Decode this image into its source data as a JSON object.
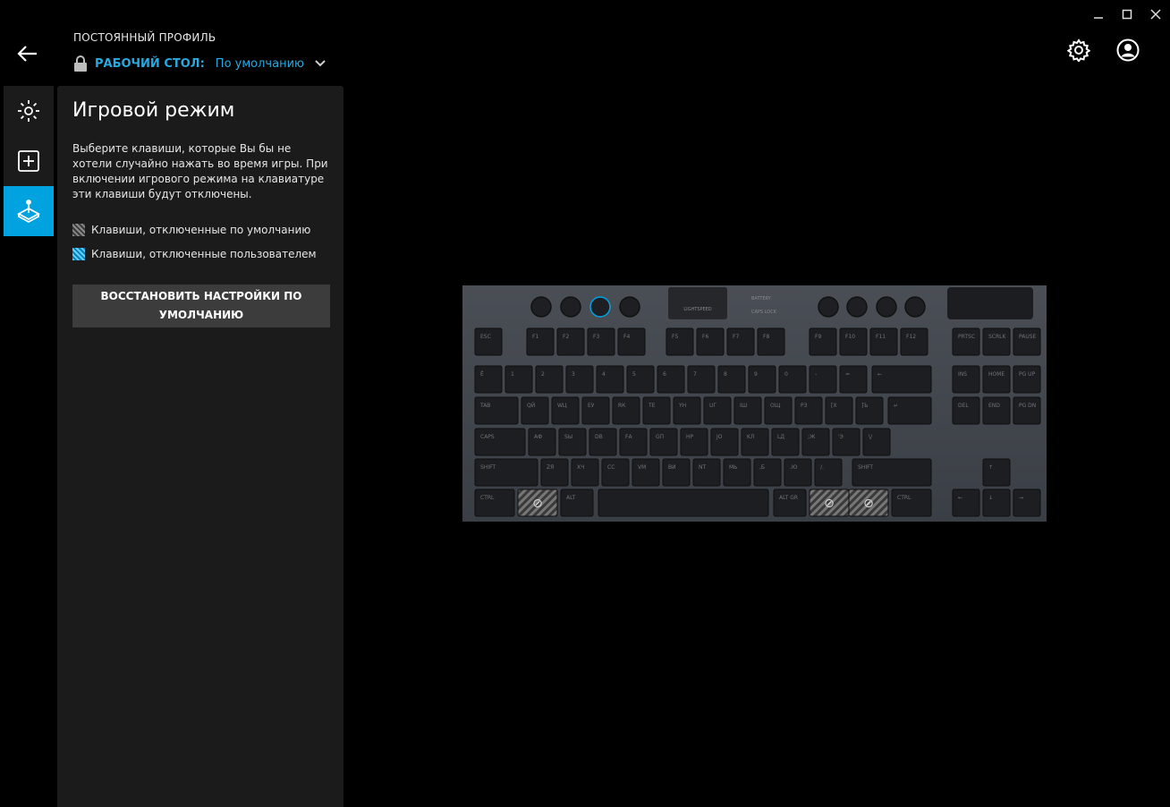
{
  "window": {
    "minimize": "—",
    "maximize": "☐",
    "close": "✕"
  },
  "header": {
    "profile_caption": "ПОСТОЯННЫЙ ПРОФИЛЬ",
    "profile_name": "РАБОЧИЙ СТОЛ:",
    "profile_value": "По умолчанию"
  },
  "rail": {
    "items": [
      {
        "icon": "lighting-icon"
      },
      {
        "icon": "assignments-icon"
      },
      {
        "icon": "game-mode-icon",
        "active": true
      }
    ]
  },
  "panel": {
    "title": "Игровой режим",
    "description": "Выберите клавиши, которые Вы бы не хотели случайно нажать во время игры. При включении игрового режима на клавиатуре эти клавиши будут отключены.",
    "legend_default": "Клавиши, отключенные по умолчанию",
    "legend_user": "Клавиши, отключенные пользователем",
    "reset_line1": "ВОССТАНОВИТЬ НАСТРОЙКИ ПО",
    "reset_line2": "УМОЛЧАНИЮ"
  },
  "keyboard": {
    "indicators": [
      "BATTERY",
      "CAPS LOCK"
    ],
    "lightspeed": "LIGHTSPEED",
    "rows": [
      [
        "ESC",
        "F1",
        "F2",
        "F3",
        "F4",
        "F5",
        "F6",
        "F7",
        "F8",
        "F9",
        "F10",
        "F11",
        "F12",
        "PRTSC",
        "SCRLK",
        "PAUSE"
      ],
      [
        "Ё",
        "1",
        "2",
        "3",
        "4",
        "5",
        "6",
        "7",
        "8",
        "9",
        "0",
        "-",
        "=",
        "←",
        "INS",
        "HOME",
        "PG UP"
      ],
      [
        "TAB",
        "QЙ",
        "WЦ",
        "EУ",
        "RК",
        "TЕ",
        "YН",
        "UГ",
        "IШ",
        "OЩ",
        "PЗ",
        "[Х",
        "]Ъ",
        "↵",
        "DEL",
        "END",
        "PG DN"
      ],
      [
        "CAPS",
        "AФ",
        "SЫ",
        "DВ",
        "FА",
        "GП",
        "HР",
        "JО",
        "KЛ",
        "LД",
        ";Ж",
        "'Э",
        "\\/"
      ],
      [
        "SHIFT",
        "ZЯ",
        "XЧ",
        "CС",
        "VМ",
        "BИ",
        "NТ",
        "MЬ",
        ",Б",
        ".Ю",
        "/.",
        "SHIFT",
        "↑"
      ],
      [
        "CTRL",
        "⊘",
        "ALT",
        "",
        "ALT GR",
        "⊘",
        "⊘",
        "CTRL",
        "←",
        "↓",
        "→"
      ]
    ]
  }
}
